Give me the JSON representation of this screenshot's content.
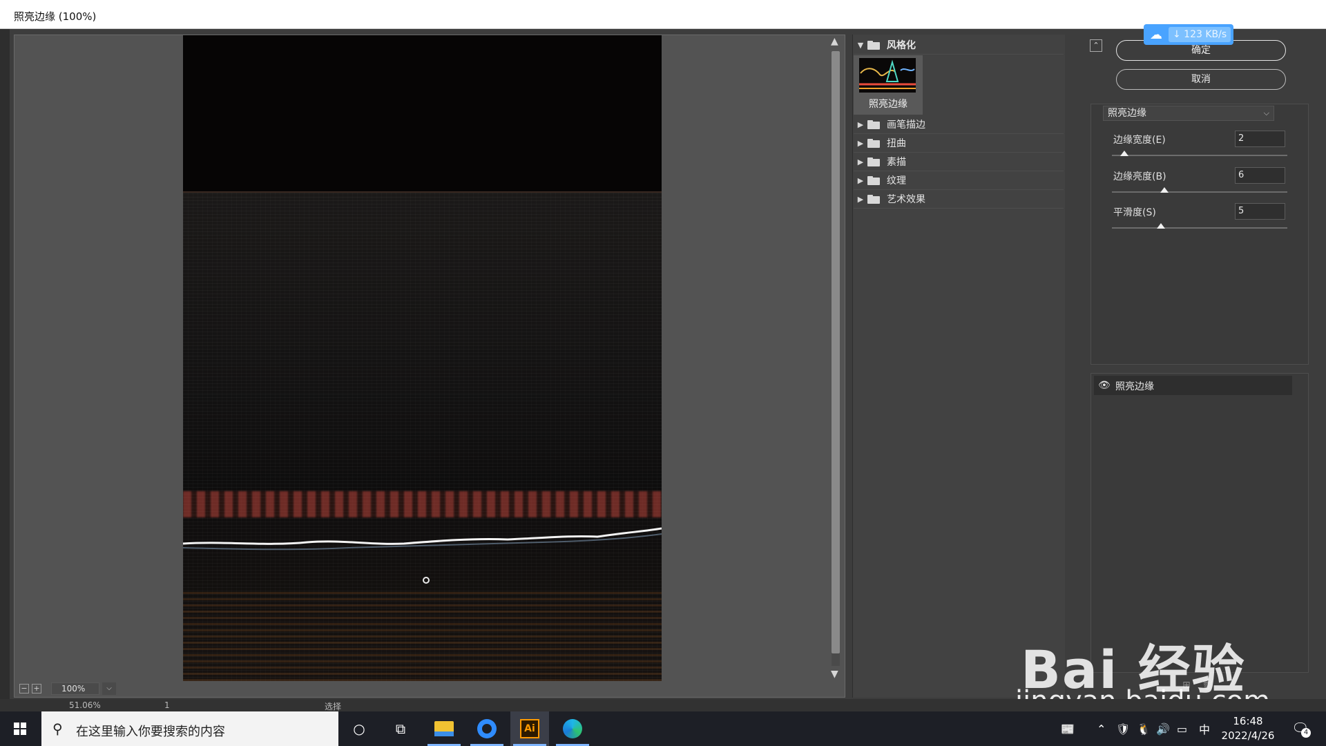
{
  "window": {
    "title": "照亮边缘 (100%)"
  },
  "preview": {
    "zoom": "100%"
  },
  "gallery": {
    "open_category": "风格化",
    "selected_filter": "照亮边缘",
    "categories": [
      "画笔描边",
      "扭曲",
      "素描",
      "纹理",
      "艺术效果"
    ]
  },
  "buttons": {
    "ok": "确定",
    "cancel": "取消"
  },
  "settings": {
    "filter": "照亮边缘",
    "params": [
      {
        "label": "边缘宽度(E)",
        "value": "2",
        "fraction": 0.07
      },
      {
        "label": "边缘亮度(B)",
        "value": "6",
        "fraction": 0.3
      },
      {
        "label": "平滑度(S)",
        "value": "5",
        "fraction": 0.28
      }
    ]
  },
  "layers": {
    "items": [
      {
        "name": "照亮边缘",
        "visible": true
      }
    ]
  },
  "download": {
    "speed": "↓ 123 KB/s"
  },
  "watermark": {
    "brand": "Bai  经验",
    "url": "jingyan.baidu.com"
  },
  "app_strip": {
    "zoom": "51.06%",
    "page": "1",
    "mode": "选择"
  },
  "taskbar": {
    "search_placeholder": "在这里输入你要搜索的内容",
    "ime": "中",
    "time": "16:48",
    "date": "2022/4/26",
    "notification_count": "4"
  },
  "colors": {
    "accent": "#49a3ff",
    "ai_orange": "#ff9a00"
  }
}
